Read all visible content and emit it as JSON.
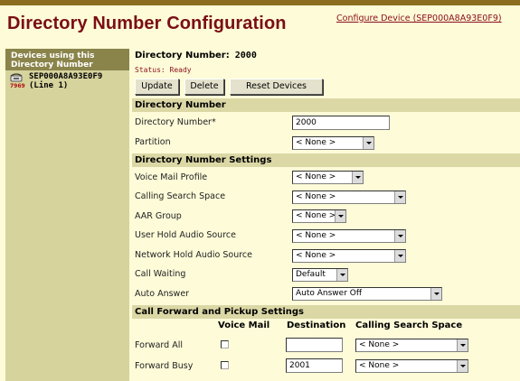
{
  "header": {
    "title": "Directory Number Configuration",
    "configure_link": "Configure Device (SEP000A8A93E0F9)"
  },
  "sidebar": {
    "heading": "Devices using this Directory Number",
    "device": {
      "name": "SEP000A8A93E0F9",
      "line": "(Line 1)",
      "extension_label": "7969",
      "icon": "phone-icon"
    }
  },
  "main": {
    "dn_label": "Directory Number:",
    "dn_value": "2000",
    "status": "Status: Ready",
    "buttons": {
      "update": "Update",
      "delete": "Delete",
      "reset": "Reset Devices"
    },
    "sections": {
      "directory_number": "Directory Number",
      "dn_settings": "Directory Number Settings",
      "call_forward": "Call Forward and Pickup Settings"
    },
    "fields": {
      "directory_number": {
        "label": "Directory Number*",
        "value": "2000"
      },
      "partition": {
        "label": "Partition",
        "value": "< None >"
      },
      "voice_mail_profile": {
        "label": "Voice Mail Profile",
        "value": "< None >"
      },
      "calling_search_space": {
        "label": "Calling Search Space",
        "value": "< None >"
      },
      "aar_group": {
        "label": "AAR Group",
        "value": "< None >"
      },
      "user_hold_audio": {
        "label": "User Hold Audio Source",
        "value": "< None >"
      },
      "network_hold_audio": {
        "label": "Network Hold Audio Source",
        "value": "< None >"
      },
      "call_waiting": {
        "label": "Call Waiting",
        "value": "Default"
      },
      "auto_answer": {
        "label": "Auto Answer",
        "value": "Auto Answer Off"
      }
    },
    "forward_columns": {
      "voice_mail": "Voice Mail",
      "destination": "Destination",
      "css": "Calling Search Space"
    },
    "forward_rows": [
      {
        "label": "Forward All",
        "voice_mail_checked": false,
        "destination": "",
        "css": "< None >"
      },
      {
        "label": "Forward Busy",
        "voice_mail_checked": false,
        "destination": "2001",
        "css": "< None >"
      }
    ]
  },
  "colors": {
    "title": "#7a0e14",
    "background": "#fdfbd8",
    "section": "#dcd8a6",
    "sidebar": "#d6d39d"
  }
}
